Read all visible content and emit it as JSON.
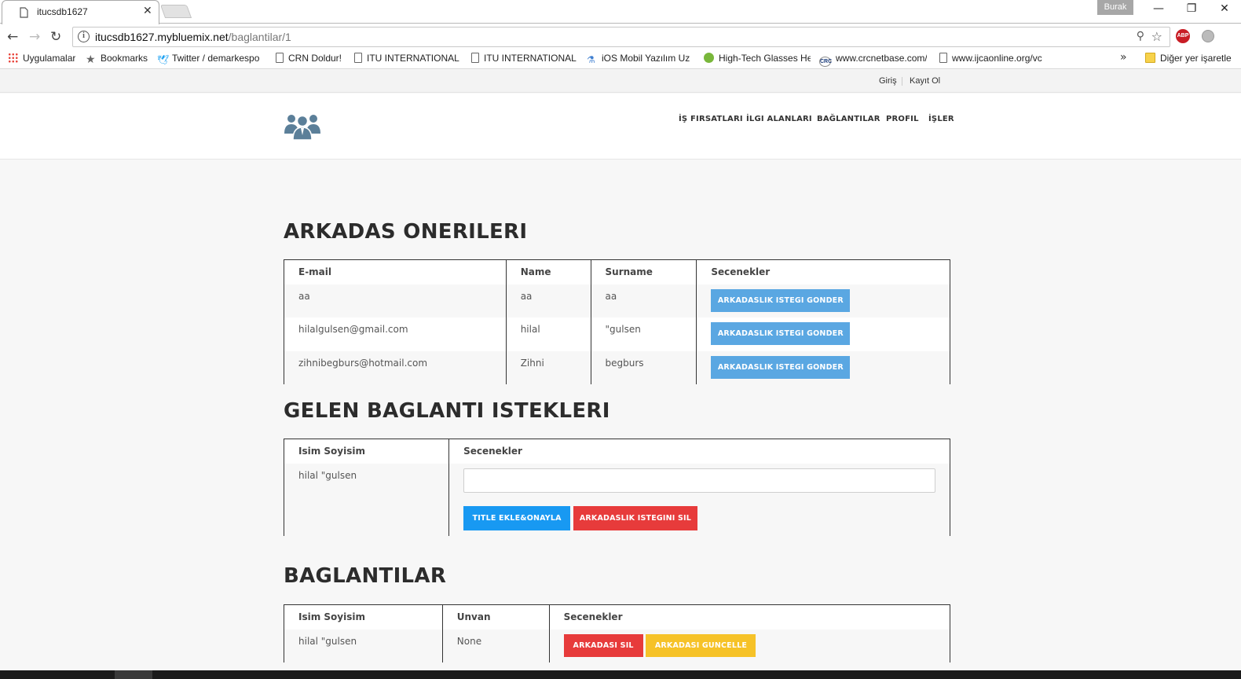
{
  "browser": {
    "tab_title": "itucsdb1627",
    "url_host": "itucsdb1627.mybluemix.net",
    "url_path": "/baglantilar/1",
    "profile": "Burak",
    "bookmarks": [
      "Uygulamalar",
      "Bookmarks",
      "Twitter / demarkespo",
      "CRN Doldur!",
      "ITU INTERNATIONAL",
      "ITU INTERNATIONAL",
      "iOS Mobil Yazılım Uz",
      "High-Tech Glasses He",
      "www.crcnetbase.com/",
      "www.ijcaonline.org/vc",
      "Diğer yer işaretle"
    ],
    "more": "»"
  },
  "site": {
    "top_links": {
      "login": "Giriş",
      "register": "Kayıt Ol"
    },
    "menu": [
      "İŞ FIRSATLARI",
      "İLGI ALANLARI",
      "BAĞLANTILAR",
      "PROFIL",
      "İŞLER"
    ]
  },
  "suggestions": {
    "heading": "ARKADAS ONERILERI",
    "columns": [
      "E-mail",
      "Name",
      "Surname",
      "Secenekler"
    ],
    "rows": [
      {
        "email": "aa",
        "name": "aa",
        "surname": "aa",
        "action": "ARKADASLIK ISTEGI GONDER"
      },
      {
        "email": "hilalgulsen@gmail.com",
        "name": "hilal",
        "surname": "\"gulsen",
        "action": "ARKADASLIK ISTEGI GONDER"
      },
      {
        "email": "zihnibegburs@hotmail.com",
        "name": "Zihni",
        "surname": "begburs",
        "action": "ARKADASLIK ISTEGI GONDER"
      }
    ]
  },
  "incoming": {
    "heading": "GELEN BAGLANTI ISTEKLERI",
    "columns": [
      "Isim Soyisim",
      "Secenekler"
    ],
    "rows": [
      {
        "full_name": "hilal \"gulsen",
        "title_input_value": "",
        "accept": "TITLE EKLE&ONAYLA",
        "reject": "ARKADASLIK ISTEGINI SIL"
      }
    ]
  },
  "connections": {
    "heading": "BAGLANTILAR",
    "columns": [
      "Isim Soyisim",
      "Unvan",
      "Secenekler"
    ],
    "rows": [
      {
        "full_name": "hilal \"gulsen",
        "title": "None",
        "delete": "ARKADASI SIL",
        "update": "ARKADASI GUNCELLE"
      }
    ]
  },
  "colors": {
    "accent_blue": "#5aa7e2",
    "cyan": "#1899f2",
    "danger": "#e73b3b",
    "warning": "#f6c228",
    "logo": "#5b7f99"
  }
}
